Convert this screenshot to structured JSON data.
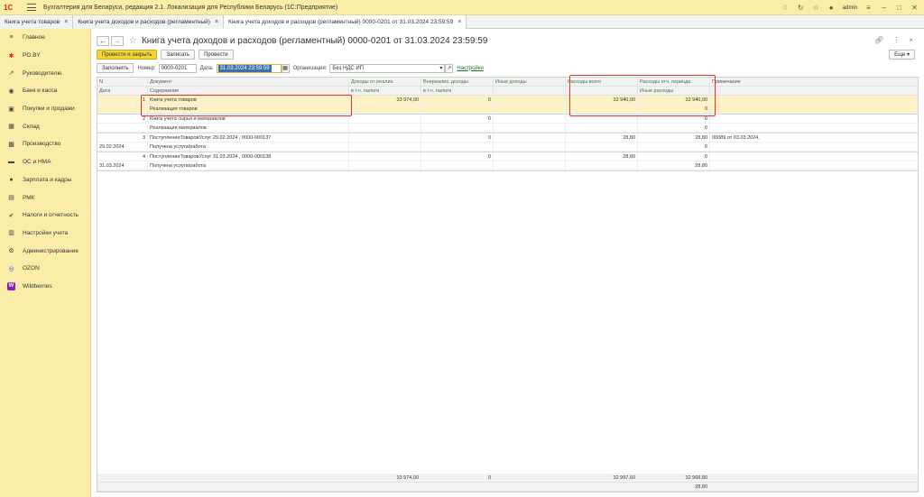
{
  "app": {
    "title": "Бухгалтерия для Беларуси, редакция 2.1. Локализация для Республики Беларусь   (1С:Предприятие)",
    "user": "admin"
  },
  "tabs": [
    {
      "label": "Книга учета товаров"
    },
    {
      "label": "Книга учета доходов и расходов (регламентный)"
    },
    {
      "label": "Книга учета доходов и расходов (регламентный) 0000-0201 от 31.03.2024 23:59:59"
    }
  ],
  "sidebar": {
    "items": [
      {
        "label": "Главное",
        "icon": "menu-icon"
      },
      {
        "label": "PO.BY",
        "icon": "star-icon"
      },
      {
        "label": "Руководителю",
        "icon": "chart-icon"
      },
      {
        "label": "Банк и касса",
        "icon": "bank-icon"
      },
      {
        "label": "Покупки и продажи",
        "icon": "cart-icon"
      },
      {
        "label": "Склад",
        "icon": "warehouse-icon"
      },
      {
        "label": "Производство",
        "icon": "factory-icon"
      },
      {
        "label": "ОС и НМА",
        "icon": "car-icon"
      },
      {
        "label": "Зарплата и кадры",
        "icon": "person-icon"
      },
      {
        "label": "РМК",
        "icon": "register-icon"
      },
      {
        "label": "Налоги и отчетность",
        "icon": "tax-icon"
      },
      {
        "label": "Настройки учета",
        "icon": "settings-doc-icon"
      },
      {
        "label": "Администрирование",
        "icon": "gear-icon"
      },
      {
        "label": "OZON",
        "icon": "ozon-icon"
      },
      {
        "label": "Wildberries",
        "icon": "wildberries-icon"
      }
    ]
  },
  "document": {
    "title": "Книга учета доходов и расходов (регламентный) 0000-0201 от 31.03.2024 23:59:59",
    "post_close": "Провести и закрыть",
    "save": "Записать",
    "post": "Провести",
    "more": "Еще",
    "fill": "Заполнить",
    "number_label": "Номер:",
    "number": "0000-0201",
    "date_label": "Дата:",
    "date": "31.03.2024 23:59:59",
    "org_label": "Организация:",
    "org": "Без НДС ИП",
    "settings_link": "Настройки"
  },
  "table": {
    "headers1": [
      "N",
      "Документ",
      "Доходы от реализ.",
      "Внереализ. доходы",
      "Иные доходы",
      "Расходы всего",
      "Расходы отч. периода",
      "Примечание"
    ],
    "headers2": [
      "Дата",
      "Содержание",
      "в т.ч. налоги",
      "в т.ч. налоги",
      "",
      "",
      "Иные расходы",
      ""
    ],
    "rows": [
      {
        "line1": {
          "n": "1",
          "date": "",
          "doc": "Книга учета товаров",
          "inc": "33 974,00",
          "nonop": "0",
          "other": "",
          "exp_total": "32 940,00",
          "exp_period": "32 940,00",
          "note": ""
        },
        "line2": {
          "n": "",
          "date": "",
          "doc": "Реализация товаров",
          "inc": "",
          "nonop": "",
          "other": "",
          "exp_total": "",
          "exp_period": "0",
          "note": ""
        }
      },
      {
        "line1": {
          "n": "2",
          "date": "",
          "doc": "Книга учета сырья и материалов",
          "inc": "",
          "nonop": "0",
          "other": "",
          "exp_total": "",
          "exp_period": "0",
          "note": ""
        },
        "line2": {
          "n": "",
          "date": "",
          "doc": "Реализация материалов",
          "inc": "",
          "nonop": "",
          "other": "",
          "exp_total": "",
          "exp_period": "0",
          "note": ""
        }
      },
      {
        "line1": {
          "n": "3",
          "date": "",
          "doc": "ПоступлениеТоваровУслуг 29.02.2024 , 0000-000137",
          "inc": "",
          "nonop": "0",
          "other": "",
          "exp_total": "28,80",
          "exp_period": "28,80",
          "note": "00089 от 03.03.2024,"
        },
        "line2": {
          "n": "",
          "date": "29.02.2024",
          "doc": "Получена услуга/работа",
          "inc": "",
          "nonop": "",
          "other": "",
          "exp_total": "",
          "exp_period": "0",
          "note": ""
        }
      },
      {
        "line1": {
          "n": "4",
          "date": "",
          "doc": "ПоступлениеТоваровУслуг 31.03.2024 , 0000-000138",
          "inc": "",
          "nonop": "0",
          "other": "",
          "exp_total": "28,80",
          "exp_period": "0",
          "note": ""
        },
        "line2": {
          "n": "",
          "date": "31.03.2024",
          "doc": "Получена услуга/работа",
          "inc": "",
          "nonop": "",
          "other": "",
          "exp_total": "",
          "exp_period": "28,80",
          "note": ""
        }
      }
    ],
    "totals1": {
      "inc": "33 974,00",
      "nonop": "0",
      "exp_total": "32 997,60",
      "exp_period": "32 968,80"
    },
    "totals2": {
      "exp_period": "28,80"
    }
  }
}
